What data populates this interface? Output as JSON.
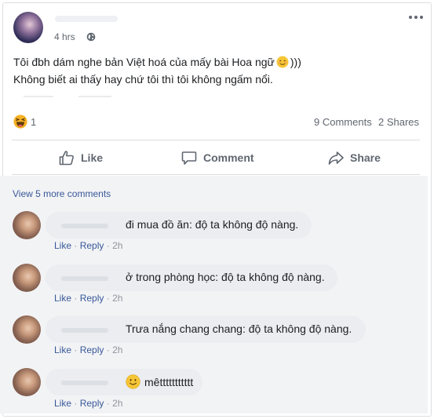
{
  "post": {
    "time": "4 hrs",
    "line1": "Tôi đbh dám nghe bản Việt hoá của mấy bài Hoa ngữ",
    "line1_suffix": ")))",
    "line2": "Không biết ai thấy hay chứ tôi thì tôi không ngấm nổi.",
    "reaction_count": "1",
    "comments_count": "9 Comments",
    "shares_count": "2 Shares",
    "actions": {
      "like": "Like",
      "comment": "Comment",
      "share": "Share"
    }
  },
  "view_more": "View 5 more comments",
  "comments": [
    {
      "text": "đi mua đồ ăn: độ ta không độ nàng.",
      "like": "Like",
      "reply": "Reply",
      "sep": "·",
      "time": "2h"
    },
    {
      "text": "ở trong phòng học: độ ta không độ nàng.",
      "like": "Like",
      "reply": "Reply",
      "sep": "·",
      "time": "2h"
    },
    {
      "text": "Trưa nắng chang chang: độ ta không độ nàng.",
      "like": "Like",
      "reply": "Reply",
      "sep": "·",
      "time": "2h"
    },
    {
      "text": "mêttttttttttt",
      "like": "Like",
      "reply": "Reply",
      "sep": "·",
      "time": "2h"
    }
  ],
  "colors": {
    "link": "#385898",
    "meta": "#606770",
    "bubble": "#ebedf0"
  }
}
